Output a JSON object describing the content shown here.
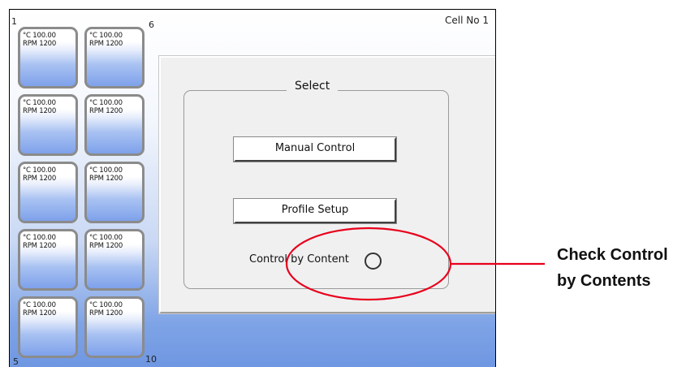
{
  "window": {
    "cell_no": "Cell No 1",
    "corner_top_left": "1",
    "corner_top_right": "6",
    "corner_bottom_left": "5",
    "corner_bottom_right": "10"
  },
  "tiles": [
    {
      "temp": "°C 100.00",
      "rpm": "RPM 1200"
    },
    {
      "temp": "°C 100.00",
      "rpm": "RPM 1200"
    },
    {
      "temp": "°C 100.00",
      "rpm": "RPM 1200"
    },
    {
      "temp": "°C 100.00",
      "rpm": "RPM 1200"
    },
    {
      "temp": "°C 100.00",
      "rpm": "RPM 1200"
    },
    {
      "temp": "°C 100.00",
      "rpm": "RPM 1200"
    },
    {
      "temp": "°C 100.00",
      "rpm": "RPM 1200"
    },
    {
      "temp": "°C 100.00",
      "rpm": "RPM 1200"
    },
    {
      "temp": "°C 100.00",
      "rpm": "RPM 1200"
    },
    {
      "temp": "°C 100.00",
      "rpm": "RPM 1200"
    }
  ],
  "select_panel": {
    "title": "Select",
    "manual_control_label": "Manual Control",
    "profile_setup_label": "Profile Setup",
    "control_by_content_label": "Control by Content"
  },
  "annotation": {
    "callout_line1": "Check Control",
    "callout_line2": "by Contents",
    "highlight_color": "#e8001c"
  }
}
